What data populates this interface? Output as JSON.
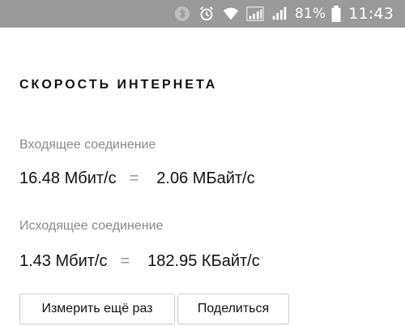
{
  "status_bar": {
    "icons": [
      "bluetooth-icon",
      "alarm-icon",
      "wifi-icon",
      "signal-icon",
      "signal-icon",
      "battery-icon"
    ],
    "battery_percent": "81%",
    "time": "11:43"
  },
  "speed_test": {
    "title": "СКОРОСТЬ ИНТЕРНЕТА",
    "download": {
      "label": "Входящее соединение",
      "mbit": "16.48 Мбит/с",
      "equals": "=",
      "bytes": "2.06 МБайт/с"
    },
    "upload": {
      "label": "Исходящее соединение",
      "mbit": "1.43 Мбит/с",
      "equals": "=",
      "bytes": "182.95 КБайт/с"
    },
    "buttons": {
      "retry": "Измерить ещё раз",
      "share": "Поделиться"
    }
  },
  "colors": {
    "status_bar_bg": "#9a9a9a",
    "label_gray": "#8a8a8a",
    "text_dark": "#111111"
  }
}
